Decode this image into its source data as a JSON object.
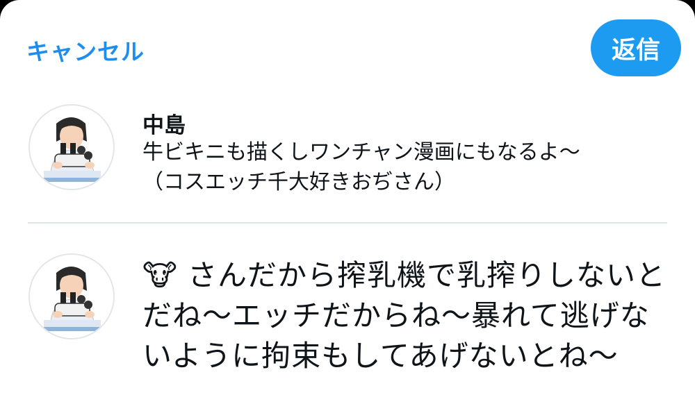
{
  "header": {
    "cancel_label": "キャンセル",
    "reply_label": "返信",
    "accent_color": "#1d9bf0"
  },
  "original_post": {
    "author_name": "中島",
    "text": "牛ビキニも描くしワンチャン漫画にもなるよ〜\n（コスエッチ千大好きおぢさん）",
    "avatar_icon": "scientist-microscope-avatar"
  },
  "compose": {
    "avatar_icon": "scientist-microscope-avatar",
    "text": "🐮 さんだから搾乳機で乳搾りしないと\nだね〜エッチだからね〜暴れて逃げな\nいように拘束もしてあげないとね〜"
  }
}
